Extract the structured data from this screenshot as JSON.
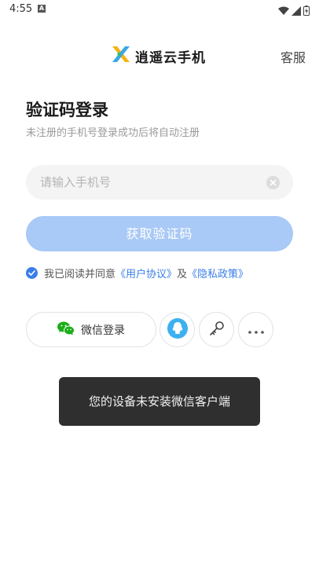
{
  "status_bar": {
    "time": "4:55",
    "notification_icon": "A",
    "icons": [
      "wifi-icon",
      "signal-icon",
      "battery-charging-icon"
    ]
  },
  "header": {
    "logo_icon": "x-logo-icon",
    "app_name": "逍遥云手机",
    "service_label": "客服"
  },
  "login": {
    "title": "验证码登录",
    "subtitle": "未注册的手机号登录成功后将自动注册",
    "phone_placeholder": "请输入手机号",
    "phone_value": "",
    "get_code_label": "获取验证码",
    "agreement": {
      "checked": true,
      "prefix": "我已阅读并同意",
      "user_agreement": "《用户协议》",
      "and": "及",
      "privacy_policy": "《隐私政策》"
    }
  },
  "login_options": {
    "wechat_label": "微信登录",
    "buttons": [
      "wechat-icon",
      "qq-icon",
      "key-icon",
      "more-icon"
    ]
  },
  "toast": {
    "message": "您的设备未安装微信客户端"
  },
  "colors": {
    "accent": "#3a7ee8",
    "button_disabled": "#a9c9f6",
    "wechat_green": "#1aad19",
    "qq_blue": "#3cb0f0"
  }
}
